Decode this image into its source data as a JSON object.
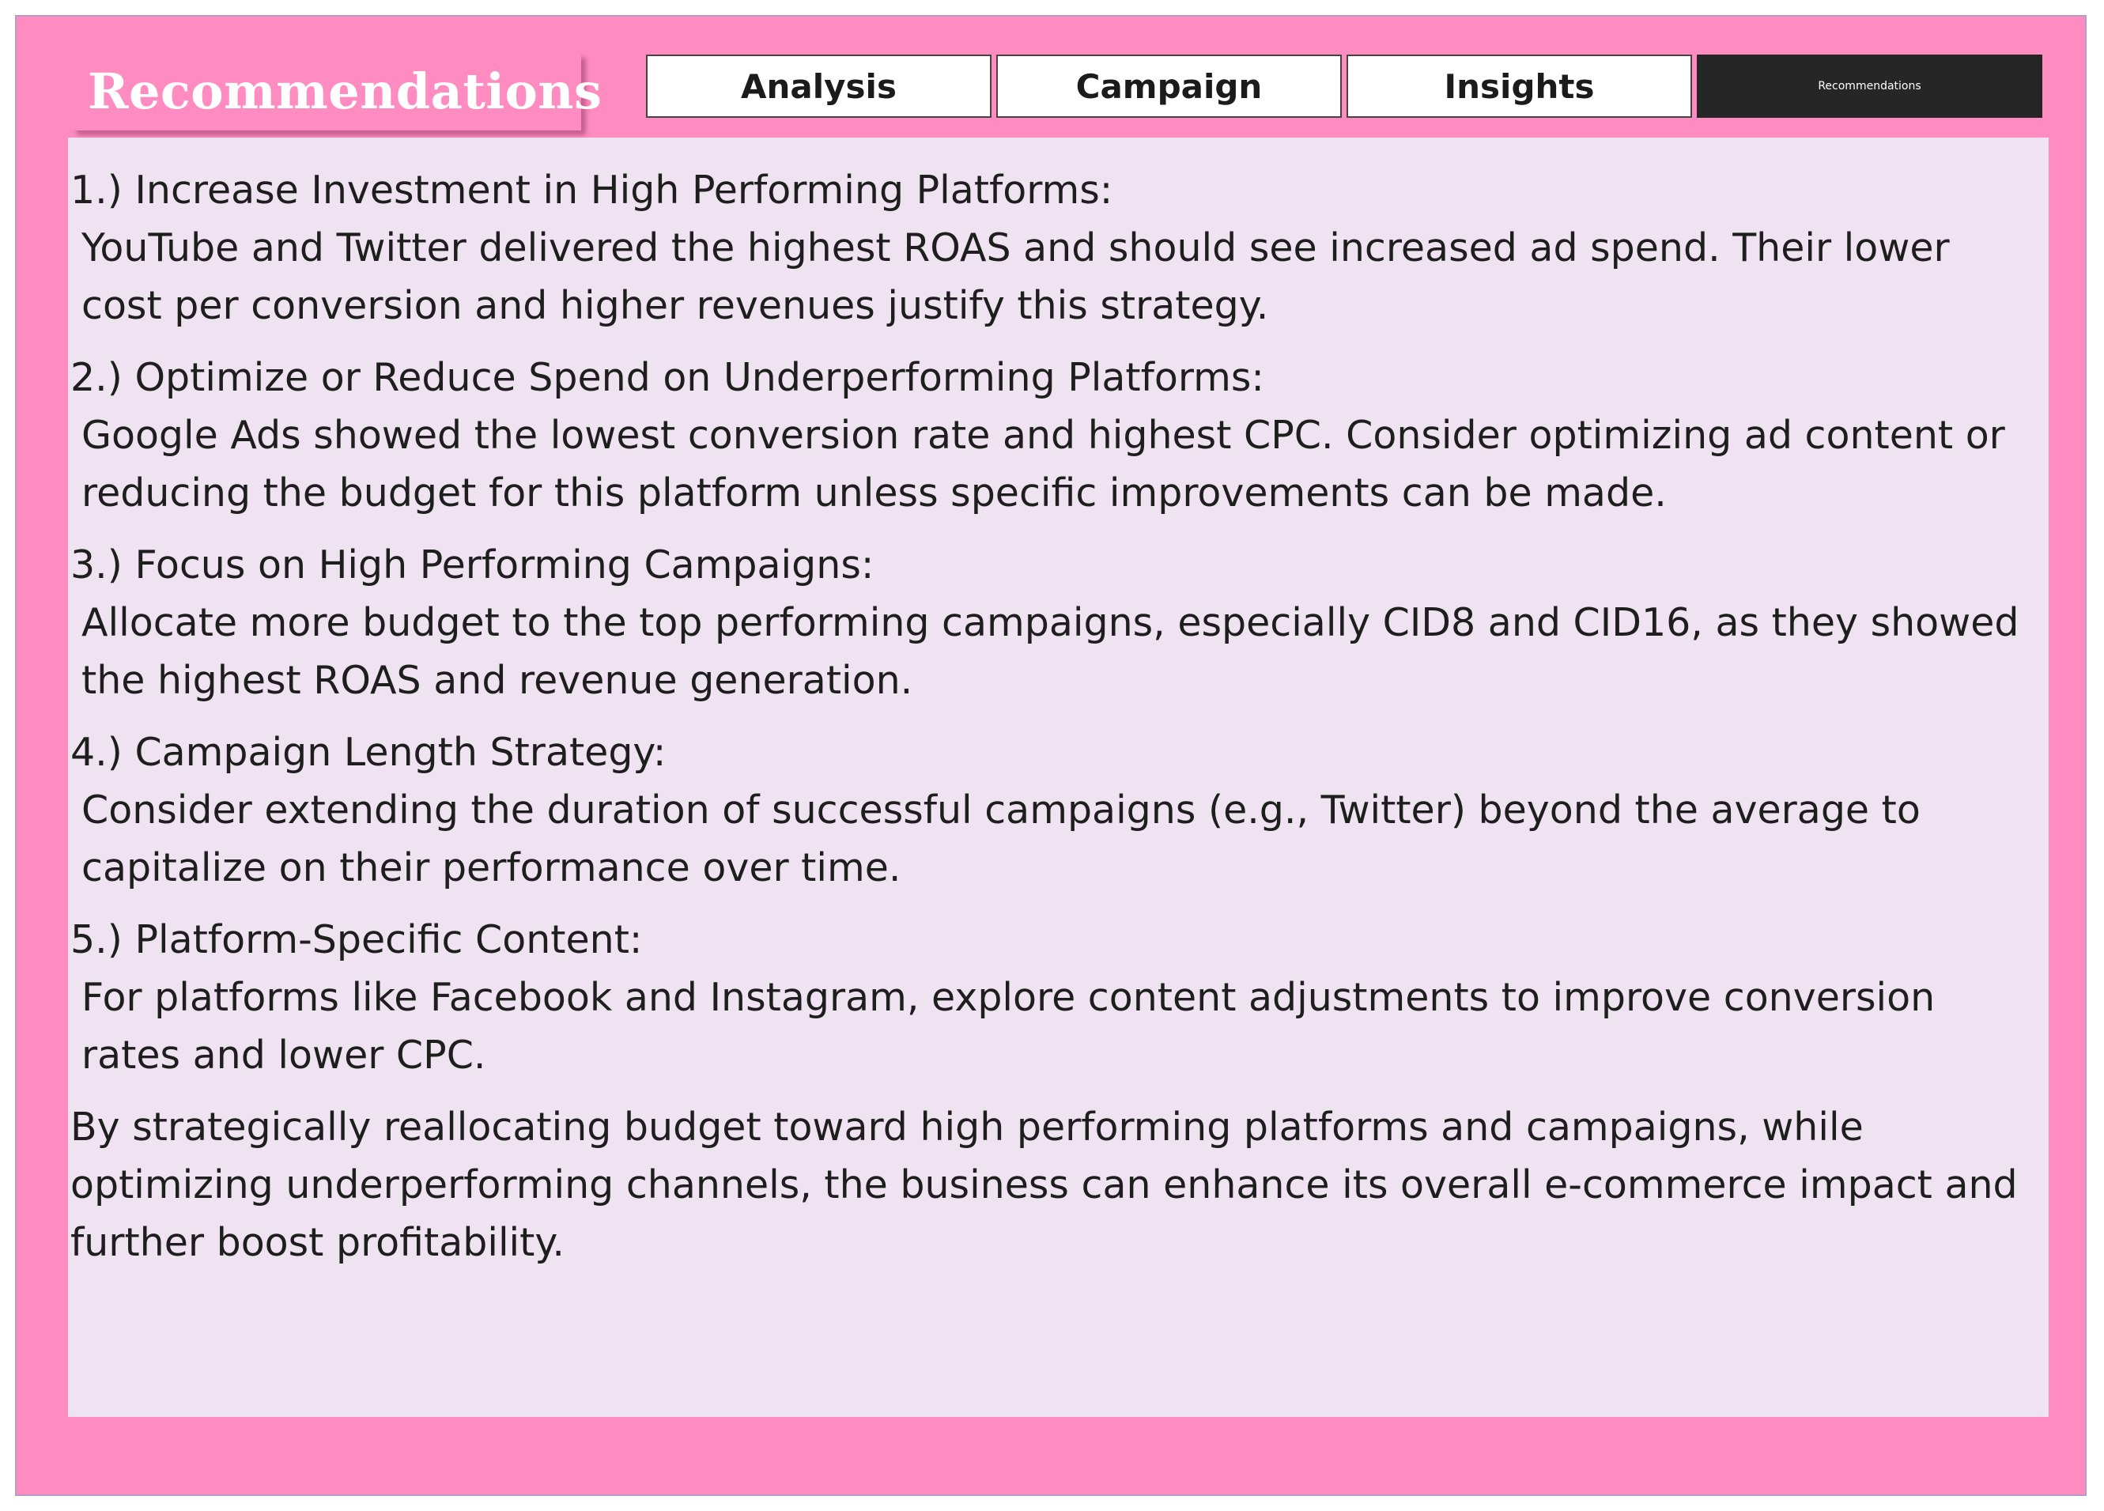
{
  "header": {
    "title": "Recommendations"
  },
  "tabs": [
    {
      "label": "Analysis",
      "active": false
    },
    {
      "label": "Campaign",
      "active": false
    },
    {
      "label": "Insights",
      "active": false
    },
    {
      "label": "Recommendations",
      "active": true
    }
  ],
  "recommendations": [
    {
      "heading": "1.) Increase Investment in High Performing Platforms:",
      "body": "YouTube and Twitter delivered the highest ROAS and should see increased ad spend. Their lower cost per conversion and higher revenues justify this strategy."
    },
    {
      "heading": "2.) Optimize or Reduce Spend on Underperforming Platforms:",
      "body": "Google Ads showed the lowest conversion rate and highest CPC. Consider optimizing ad content or reducing the budget for this platform unless specific improvements can be made."
    },
    {
      "heading": "3.) Focus on High Performing Campaigns:",
      "body": "Allocate more budget to the top performing campaigns, especially CID8 and CID16, as they showed the highest ROAS and revenue generation."
    },
    {
      "heading": "4.) Campaign Length Strategy:",
      "body": "Consider extending the duration of successful campaigns (e.g., Twitter) beyond the average to capitalize on their performance over time."
    },
    {
      "heading": "5.) Platform-Specific Content:",
      "body": "For platforms like Facebook and Instagram, explore content adjustments to improve conversion rates and lower CPC."
    }
  ],
  "conclusion": "By strategically reallocating budget toward high performing platforms and campaigns, while optimizing underperforming channels, the business can enhance its overall e-commerce impact and further boost profitability.",
  "colors": {
    "background": "#ff8cc0",
    "panel": "#f0e3f1",
    "active_tab": "#262626",
    "tab": "#ffffff"
  }
}
